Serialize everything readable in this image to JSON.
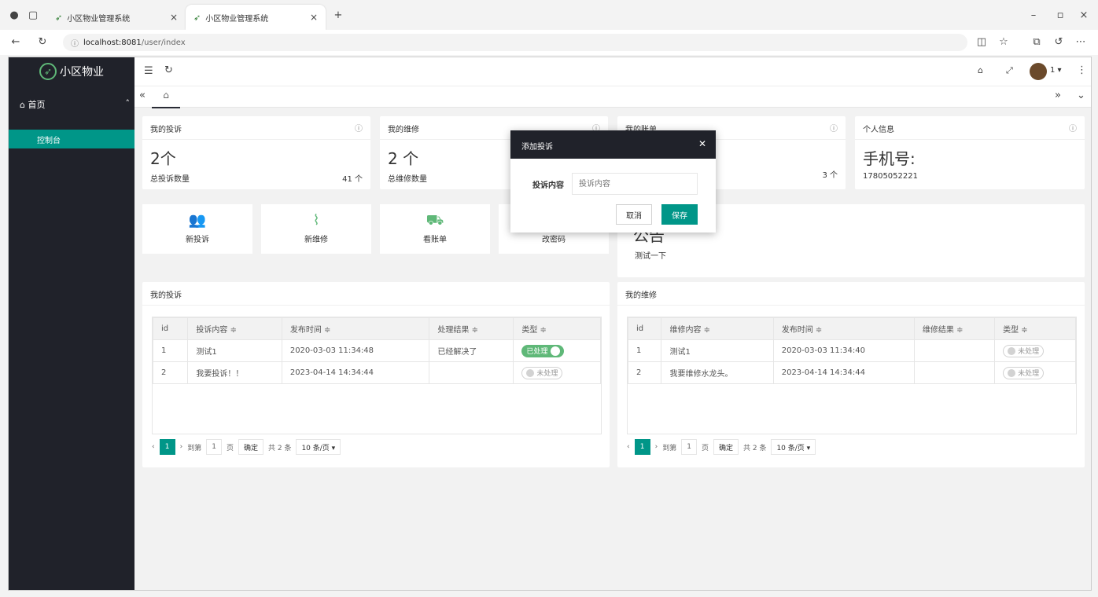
{
  "browser": {
    "tabs": [
      {
        "title": "小区物业管理系统"
      },
      {
        "title": "小区物业管理系统"
      }
    ],
    "url_host": "localhost:8081",
    "url_path": "/user/index",
    "profile_badge": "1"
  },
  "sidebar": {
    "brand": "小区物业",
    "home": "首页",
    "console": "控制台"
  },
  "cards": {
    "complaints": {
      "title": "我的投诉",
      "count": "2个",
      "footer_label": "总投诉数量",
      "footer_value": "41 个"
    },
    "repairs": {
      "title": "我的维修",
      "count": "2 个",
      "footer_label": "总维修数量"
    },
    "bills": {
      "title": "我的账单",
      "footer_value": "3 个"
    },
    "profile": {
      "title": "个人信息",
      "phone_label": "手机号:",
      "phone": "17805052221"
    }
  },
  "quick": [
    {
      "label": "新投诉",
      "icon": "users-icon"
    },
    {
      "label": "新维修",
      "icon": "pulse-icon"
    },
    {
      "label": "看账单",
      "icon": "cart-icon"
    },
    {
      "label": "改密码",
      "icon": "key-icon"
    }
  ],
  "notice": {
    "title": "公告",
    "text": "测试一下"
  },
  "complaint_table": {
    "title": "我的投诉",
    "headers": [
      "id",
      "投诉内容 ≑",
      "发布时间 ≑",
      "处理结果 ≑",
      "类型 ≑"
    ],
    "rows": [
      {
        "id": "1",
        "content": "测试1",
        "time": "2020-03-03 11:34:48",
        "result": "已经解决了",
        "status": "已处理"
      },
      {
        "id": "2",
        "content": "我要投诉！！",
        "time": "2023-04-14 14:34:44",
        "result": "",
        "status": "未处理"
      }
    ]
  },
  "repair_table": {
    "title": "我的维修",
    "headers": [
      "id",
      "维修内容 ≑",
      "发布时间 ≑",
      "维修结果 ≑",
      "类型 ≑"
    ],
    "rows": [
      {
        "id": "1",
        "content": "测试1",
        "time": "2020-03-03 11:34:40",
        "result": "",
        "status": "未处理"
      },
      {
        "id": "2",
        "content": "我要维修水龙头。",
        "time": "2023-04-14 14:34:44",
        "result": "",
        "status": "未处理"
      }
    ]
  },
  "pager": {
    "page": "1",
    "goto": "到第",
    "page_input": "1",
    "page_unit": "页",
    "confirm": "确定",
    "total": "共 2 条",
    "per_page": "10 条/页 ▾"
  },
  "dialog": {
    "title": "添加投诉",
    "label": "投诉内容",
    "placeholder": "投诉内容",
    "cancel": "取消",
    "save": "保存"
  },
  "colors": {
    "accent": "#009688",
    "sidebar": "#20222a",
    "switch_on": "#5fb878"
  }
}
